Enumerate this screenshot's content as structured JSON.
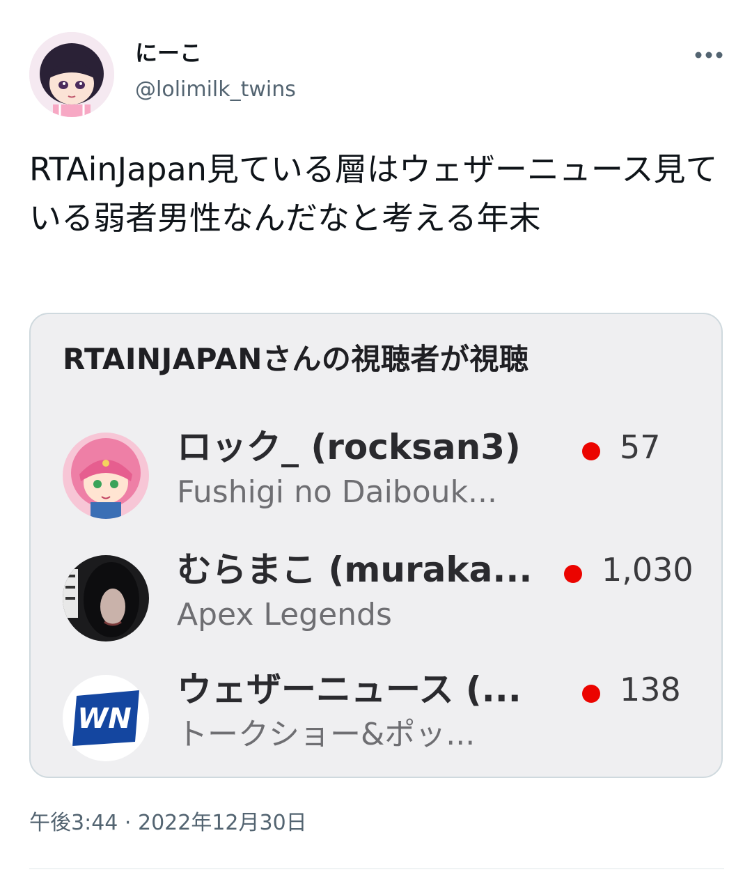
{
  "author": {
    "display_name": "にーこ",
    "handle": "@lolimilk_twins"
  },
  "tweet": {
    "text": "RTAinJapan見ている層はウェザーニュース見ている弱者男性なんだなと考える年末",
    "timestamp": "午後3:44 · 2022年12月30日"
  },
  "card": {
    "heading": "RTAINJAPANさんの視聴者が視聴",
    "live_color": "#eb0400",
    "channels": [
      {
        "name": "ロック_ (rocksan3)",
        "game": "Fushigi no Daibouk...",
        "viewers": "57",
        "avatar_icon": "anime-girl-avatar-icon"
      },
      {
        "name": "むらまこ (muraka...",
        "game": "Apex Legends",
        "viewers": "1,030",
        "avatar_icon": "dark-photo-avatar-icon"
      },
      {
        "name": "ウェザーニュース (...",
        "game": "トークショー&ポッ...",
        "viewers": "138",
        "avatar_icon": "wn-logo-icon"
      }
    ]
  },
  "colors": {
    "text_primary": "#0f1419",
    "text_secondary": "#536471",
    "card_background": "#efeff1",
    "card_border": "#cfd9de"
  }
}
